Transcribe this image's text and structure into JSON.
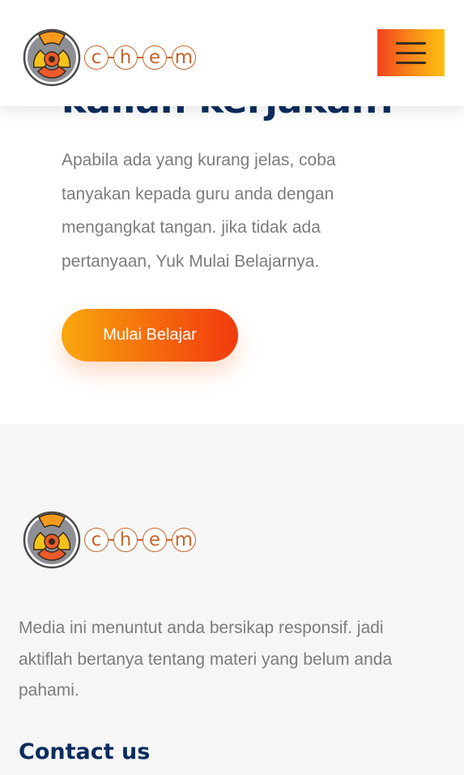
{
  "header": {
    "logo_letters": [
      "c",
      "h",
      "e",
      "m"
    ],
    "menu_icon": "hamburger-menu-icon"
  },
  "hero": {
    "heading_partial": "kalian kerjakan?",
    "paragraph": "Apabila ada yang kurang jelas, coba tanyakan kepada guru anda dengan mengangkat tangan. jika tidak ada pertanyaan, Yuk Mulai Belajarnya.",
    "cta_label": "Mulai Belajar"
  },
  "footer": {
    "logo_letters": [
      "c",
      "h",
      "e",
      "m"
    ],
    "description": "Media ini menuntut anda bersikap responsif. jadi aktiflah bertanya tentang materi yang belum anda pahami.",
    "contact_heading": "Contact us"
  },
  "colors": {
    "brand_navy": "#0b2d5e",
    "accent_orange": "#f5620c",
    "accent_yellow": "#f8a80d",
    "logo_outline": "#c7642a",
    "body_text": "#7c7c7c",
    "footer_bg": "#f6f6f6"
  }
}
